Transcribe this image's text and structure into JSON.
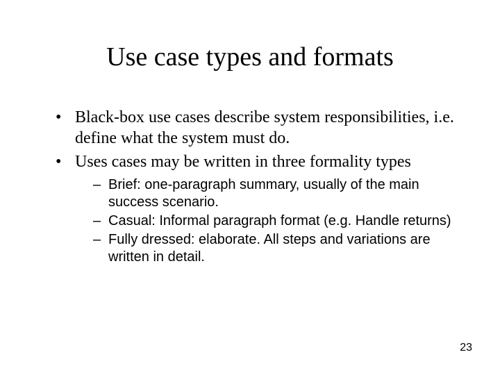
{
  "title": "Use case types and formats",
  "bullets": [
    {
      "text": "Black-box use cases describe system responsibilities, i.e. define what the system must do."
    },
    {
      "text": "Uses cases may be written in three formality types",
      "sub": [
        "Brief: one-paragraph summary, usually of the main success scenario.",
        "Casual: Informal paragraph format (e.g. Handle returns)",
        "Fully dressed: elaborate. All steps and variations are written in detail."
      ]
    }
  ],
  "page_number": "23"
}
